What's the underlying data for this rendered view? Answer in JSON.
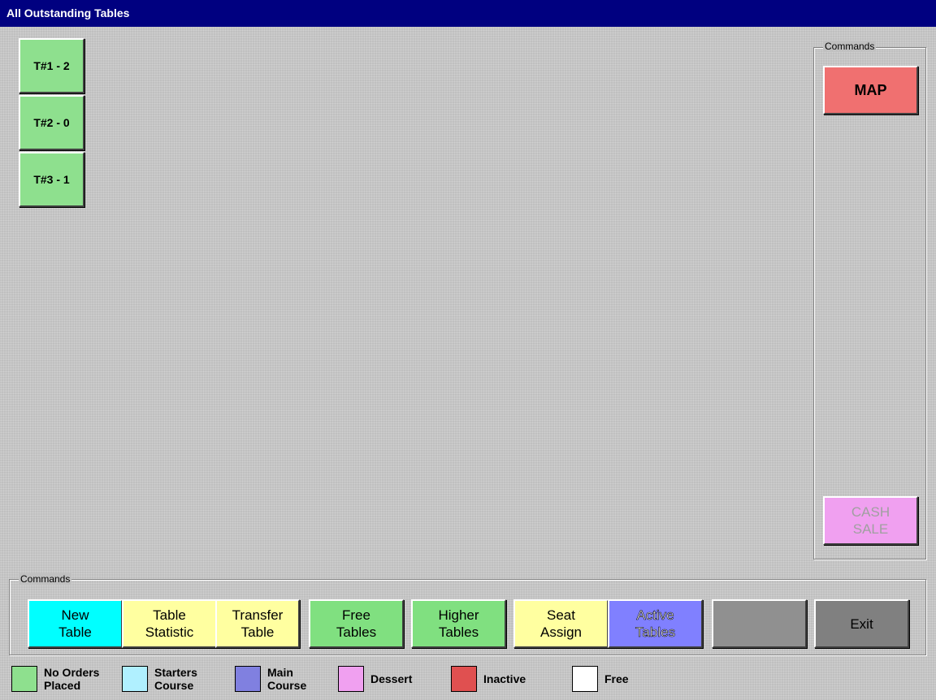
{
  "window": {
    "title": "All Outstanding Tables"
  },
  "tables": [
    {
      "label": "T#1 - 2",
      "color": "#8ee08e"
    },
    {
      "label": "T#2 - 0",
      "color": "#8ee08e"
    },
    {
      "label": "T#3 - 1",
      "color": "#8ee08e"
    }
  ],
  "side_commands": {
    "legend": "Commands",
    "map_label": "MAP",
    "map_color": "#f07070",
    "cash_sale_label": "CASH\nSALE",
    "cash_sale_color": "#f0a0f0"
  },
  "bottom_commands": {
    "legend": "Commands",
    "buttons": [
      {
        "label": "New\nTable",
        "color": "#00ffff"
      },
      {
        "label": "Table\nStatistic",
        "color": "#ffffa0"
      },
      {
        "label": "Transfer\nTable",
        "color": "#ffffa0"
      },
      {
        "label": "Free\nTables",
        "color": "#80e080"
      },
      {
        "label": "Higher\nTables",
        "color": "#80e080"
      },
      {
        "label": "Seat\nAssign",
        "color": "#ffffa0"
      },
      {
        "label": "Active\nTables",
        "color": "#8080ff"
      },
      {
        "label": "",
        "color": "#909090"
      },
      {
        "label": "Exit",
        "color": "#808080"
      }
    ]
  },
  "legend": [
    {
      "label": "No Orders\nPlaced",
      "color": "#8ee08e"
    },
    {
      "label": "Starters\nCourse",
      "color": "#b0f0ff"
    },
    {
      "label": "Main\nCourse",
      "color": "#8080e0"
    },
    {
      "label": "Dessert",
      "color": "#f0a0f0"
    },
    {
      "label": "Inactive",
      "color": "#e05050"
    },
    {
      "label": "Free",
      "color": "#ffffff"
    }
  ]
}
